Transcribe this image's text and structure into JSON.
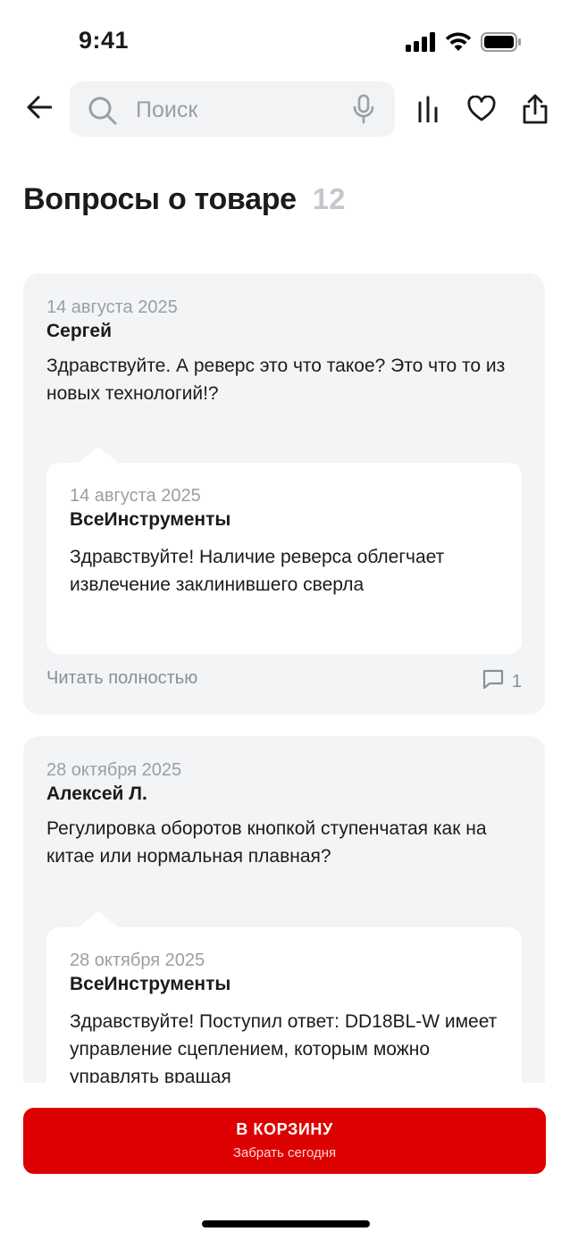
{
  "status_bar": {
    "time": "9:41"
  },
  "search": {
    "placeholder": "Поиск"
  },
  "page": {
    "title": "Вопросы о товаре",
    "count": "12"
  },
  "questions": [
    {
      "date": "14 августа 2025",
      "author": "Сергей",
      "text": "Здравствуйте. А реверс это что такое? Это что то из новых технологий!?",
      "answer": {
        "date": "14 августа 2025",
        "author": "ВсеИнструменты",
        "text": "Здравствуйте! Наличие реверса облегчает извлечение заклинившего сверла"
      },
      "read_more": "Читать полностью",
      "comments_count": "1"
    },
    {
      "date": "28 октября 2025",
      "author": "Алексей Л.",
      "text": "Регулировка оборотов кнопкой ступенчатая как на китае или нормальная плавная?",
      "answer": {
        "date": "28 октября 2025",
        "author": "ВсеИнструменты",
        "text": "Здравствуйте! Поступил ответ: DD18BL-W имеет управление сцеплением, которым можно управлять вращая"
      }
    }
  ],
  "cart_button": {
    "label": "В КОРЗИНУ",
    "sublabel": "Забрать сегодня"
  },
  "colors": {
    "accent": "#dd0000",
    "card_bg": "#f3f4f6",
    "muted": "#9a9ea6"
  }
}
